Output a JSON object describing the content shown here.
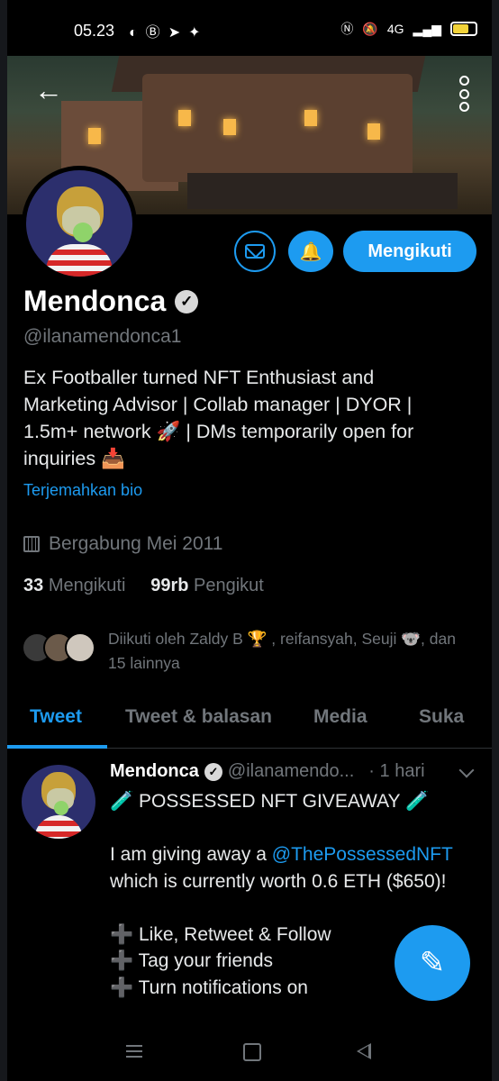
{
  "status_bar": {
    "time": "05.23",
    "left_icons": [
      "discord-icon",
      "b-icon",
      "telegram-icon",
      "twitter-icon"
    ],
    "network": "4G",
    "battery_level": 0.85
  },
  "profile": {
    "name": "Mendonca",
    "handle": "@ilanamendonca1",
    "bio": "Ex Footballer turned NFT Enthusiast and\nMarketing Advisor | Collab manager | DYOR |\n1.5m+ network 🚀 | DMs temporarily open for\ninquiries 📥",
    "translate_label": "Terjemahkan bio",
    "joined": "Bergabung Mei 2011",
    "following_count": "33",
    "following_label": "Mengikuti",
    "followers_count": "99rb",
    "followers_label": "Pengikut",
    "followed_by": "Diikuti oleh Zaldy B 🏆 , reifansyah, Seuji 🐨, dan 15 lainnya"
  },
  "actions": {
    "follow_label": "Mengikuti"
  },
  "tabs": [
    {
      "label": "Tweet",
      "active": true
    },
    {
      "label": "Tweet & balasan",
      "active": false
    },
    {
      "label": "Media",
      "active": false
    },
    {
      "label": "Suka",
      "active": false
    }
  ],
  "tweet": {
    "name": "Mendonca",
    "handle": "@ilanamendo...",
    "time": "· 1 hari",
    "line1": "🧪 POSSESSED NFT GIVEAWAY 🧪",
    "line2_pre": "I am giving away a ",
    "line2_mention": "@ThePossessedNFT",
    "line3": "which is currently worth 0.6 ETH ($650)!",
    "line4": "➕ Like, Retweet & Follow",
    "line5": "➕ Tag your friends",
    "line6": "➕ Turn notifications on"
  },
  "colors": {
    "accent": "#1d9bf0",
    "background": "#000000",
    "muted": "#71767b"
  }
}
